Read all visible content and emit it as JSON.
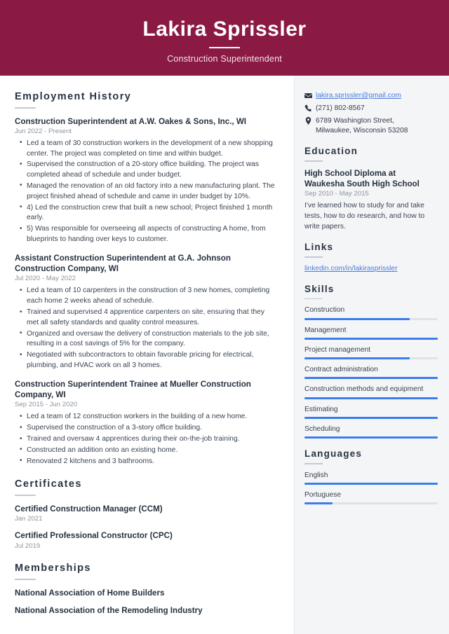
{
  "header": {
    "name": "Lakira Sprissler",
    "job_title": "Construction Superintendent",
    "background_color": "#8a1a43"
  },
  "accent_color": "#3b7def",
  "link_color": "#4a7ddd",
  "main": {
    "employment": {
      "heading": "Employment History",
      "entries": [
        {
          "title": "Construction Superintendent at A.W. Oakes & Sons, Inc., WI",
          "date": "Jun 2022 - Present",
          "bullets": [
            "Led a team of 30 construction workers in the development of a new shopping center. The project was completed on time and within budget.",
            "Supervised the construction of a 20-story office building. The project was completed ahead of schedule and under budget.",
            "Managed the renovation of an old factory into a new manufacturing plant. The project finished ahead of schedule and came in under budget by 10%.",
            "4) Led the construction crew that built a new school; Project finished 1 month early.",
            "5) Was responsible for overseeing all aspects of constructing A home, from blueprints to handing over keys to customer."
          ]
        },
        {
          "title": "Assistant Construction Superintendent at G.A. Johnson Construction Company, WI",
          "date": "Jul 2020 - May 2022",
          "bullets": [
            "Led a team of 10 carpenters in the construction of 3 new homes, completing each home 2 weeks ahead of schedule.",
            "Trained and supervised 4 apprentice carpenters on site, ensuring that they met all safety standards and quality control measures.",
            "Organized and oversaw the delivery of construction materials to the job site, resulting in a cost savings of 5% for the company.",
            "Negotiated with subcontractors to obtain favorable pricing for electrical, plumbing, and HVAC work on all 3 homes."
          ]
        },
        {
          "title": "Construction Superintendent Trainee at Mueller Construction Company, WI",
          "date": "Sep 2015 - Jun 2020",
          "bullets": [
            "Led a team of 12 construction workers in the building of a new home.",
            "Supervised the construction of a 3-story office building.",
            "Trained and oversaw 4 apprentices during their on-the-job training.",
            "Constructed an addition onto an existing home.",
            "Renovated 2 kitchens and 3 bathrooms."
          ]
        }
      ]
    },
    "certificates": {
      "heading": "Certificates",
      "entries": [
        {
          "title": "Certified Construction Manager (CCM)",
          "date": "Jan 2021"
        },
        {
          "title": "Certified Professional Constructor (CPC)",
          "date": "Jul 2019"
        }
      ]
    },
    "memberships": {
      "heading": "Memberships",
      "entries": [
        {
          "title": "National Association of Home Builders"
        },
        {
          "title": "National Association of the Remodeling Industry"
        }
      ]
    }
  },
  "sidebar": {
    "contact": [
      {
        "icon": "envelope-icon",
        "text": "lakira.sprissler@gmail.com",
        "is_link": true
      },
      {
        "icon": "phone-icon",
        "text": "(271) 802-8567",
        "is_link": false
      },
      {
        "icon": "location-pin-icon",
        "text": "6789 Washington Street,",
        "text2": "Milwaukee, Wisconsin 53208",
        "is_link": false
      }
    ],
    "education": {
      "heading": "Education",
      "entries": [
        {
          "title": "High School Diploma at Waukesha South High School",
          "date": "Sep 2010 - May 2015",
          "description": "I've learned how to study for and take tests, how to do research, and how to write papers."
        }
      ]
    },
    "links": {
      "heading": "Links",
      "items": [
        {
          "label": "linkedin.com/in/lakirasprissler"
        }
      ]
    },
    "skills": {
      "heading": "Skills",
      "items": [
        {
          "label": "Construction",
          "level": 79
        },
        {
          "label": "Management",
          "level": 100
        },
        {
          "label": "Project management",
          "level": 79
        },
        {
          "label": "Contract administration",
          "level": 100
        },
        {
          "label": "Construction methods and equipment",
          "level": 100
        },
        {
          "label": "Estimating",
          "level": 100
        },
        {
          "label": "Scheduling",
          "level": 100
        }
      ]
    },
    "languages": {
      "heading": "Languages",
      "items": [
        {
          "label": "English",
          "level": 100
        },
        {
          "label": "Portuguese",
          "level": 21
        }
      ]
    }
  }
}
